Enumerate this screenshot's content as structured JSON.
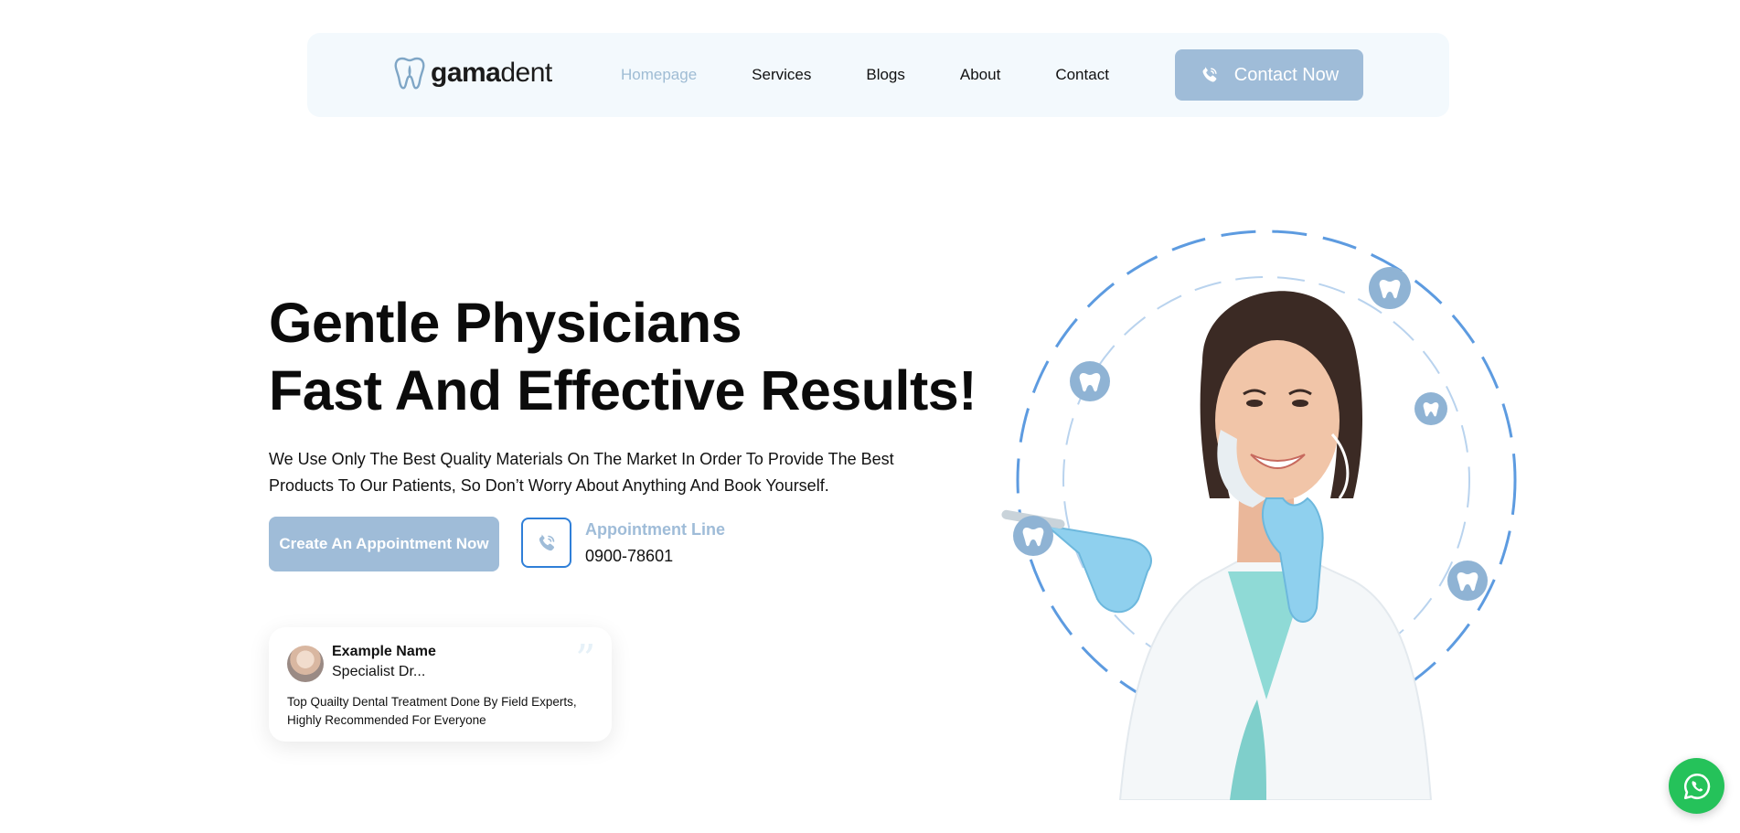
{
  "brand": {
    "name_bold": "gama",
    "name_regular": "dent"
  },
  "nav": {
    "items": [
      {
        "label": "Homepage",
        "active": true
      },
      {
        "label": "Services",
        "active": false
      },
      {
        "label": "Blogs",
        "active": false
      },
      {
        "label": "About",
        "active": false
      },
      {
        "label": "Contact",
        "active": false
      }
    ],
    "cta_label": "Contact Now",
    "cta_icon": "phone-icon"
  },
  "hero": {
    "title_line1": "Gentle Physicians",
    "title_line2": "Fast And Effective Results!",
    "description": "We Use Only The Best Quality Materials On The Market In Order To Provide The Best Products To Our Patients, So Don’t Worry About Anything And Book Yourself.",
    "appointment_button": "Create An Appointment Now",
    "appointment_line_label": "Appointment Line",
    "appointment_line_number": "0900-78601"
  },
  "testimonial": {
    "name": "Example Name",
    "role": "Specialist Dr...",
    "text": "Top Quailty Dental Treatment Done By Field Experts, Highly Recommended For Everyone",
    "quote_mark": "”"
  },
  "colors": {
    "accent": "#9fbcd8",
    "nav_bg": "#f3f9fd",
    "icon_blue": "#2f7fd8",
    "whatsapp": "#25c25a"
  },
  "floating_icons": [
    "tooth-icon",
    "tooth-icon",
    "tooth-icon",
    "tooth-icon",
    "tooth-icon"
  ],
  "whatsapp_icon": "whatsapp-icon"
}
